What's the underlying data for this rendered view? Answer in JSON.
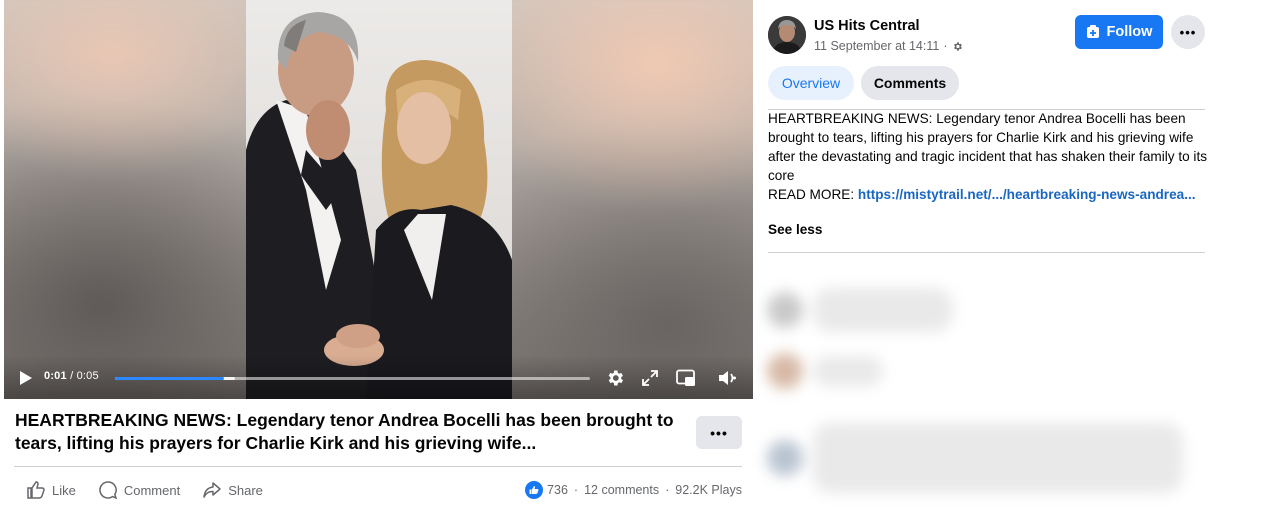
{
  "video": {
    "current_time": "0:01",
    "separator": " / ",
    "duration": "0:05",
    "progress_fraction": 0.23
  },
  "post": {
    "title": "HEARTBREAKING NEWS: Legendary tenor Andrea Bocelli has been brought to tears, lifting his prayers for Charlie Kirk and his grieving wife...",
    "actions": {
      "like": "Like",
      "comment": "Comment",
      "share": "Share"
    },
    "stats": {
      "reactions": "736",
      "comments": "12 comments",
      "plays": "92.2K Plays",
      "dot": "·"
    }
  },
  "sidebar": {
    "page_name": "US Hits Central",
    "post_time": "11 September at 14:11",
    "follow_label": "Follow",
    "tabs": [
      {
        "label": "Overview",
        "active": true
      },
      {
        "label": "Comments",
        "active": false
      }
    ],
    "description": "HEARTBREAKING NEWS: Legendary tenor Andrea Bocelli has been brought to tears, lifting his prayers for Charlie Kirk and his grieving wife after the devastating and tragic incident that has shaken their family to its core",
    "read_more_label": "READ MORE: ",
    "read_more_link": "https://mistytrail.net/.../heartbreaking-news-andrea...",
    "see_less": "See less"
  },
  "colors": {
    "accent": "#1877f2",
    "link": "#1a67c2",
    "muted_text": "#65676b",
    "button_gray": "#e4e6eb"
  },
  "icons": [
    "play-icon",
    "settings-icon",
    "fullscreen-icon",
    "picture-in-picture-icon",
    "volume-icon",
    "like-icon",
    "comment-icon",
    "share-icon",
    "follow-icon",
    "globe-settings-icon",
    "more-icon"
  ]
}
